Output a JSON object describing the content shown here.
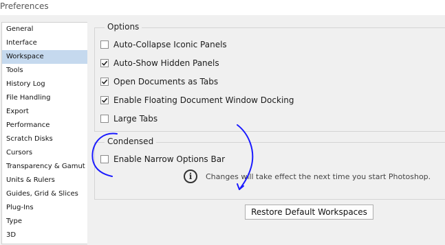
{
  "window": {
    "title": "Preferences"
  },
  "sidebar": {
    "items": [
      {
        "label": "General"
      },
      {
        "label": "Interface"
      },
      {
        "label": "Workspace",
        "active": true
      },
      {
        "label": "Tools"
      },
      {
        "label": "History Log"
      },
      {
        "label": "File Handling"
      },
      {
        "label": "Export"
      },
      {
        "label": "Performance"
      },
      {
        "label": "Scratch Disks"
      },
      {
        "label": "Cursors"
      },
      {
        "label": "Transparency & Gamut"
      },
      {
        "label": "Units & Rulers"
      },
      {
        "label": "Guides, Grid & Slices"
      },
      {
        "label": "Plug-Ins"
      },
      {
        "label": "Type"
      },
      {
        "label": "3D"
      }
    ]
  },
  "options": {
    "legend": "Options",
    "items": [
      {
        "label": "Auto-Collapse Iconic Panels",
        "checked": false
      },
      {
        "label": "Auto-Show Hidden Panels",
        "checked": true
      },
      {
        "label": "Open Documents as Tabs",
        "checked": true
      },
      {
        "label": "Enable Floating Document Window Docking",
        "checked": true
      },
      {
        "label": "Large Tabs",
        "checked": false
      }
    ]
  },
  "condensed": {
    "legend": "Condensed",
    "items": [
      {
        "label": "Enable Narrow Options Bar",
        "checked": false
      }
    ]
  },
  "info": {
    "icon": "info-icon",
    "text": "Changes will take effect the next time you start Photoshop."
  },
  "restore_button": {
    "label": "Restore Default Workspaces"
  },
  "colors": {
    "active_item": "#c5d9ee",
    "annotation_ink": "#1a1aff"
  }
}
